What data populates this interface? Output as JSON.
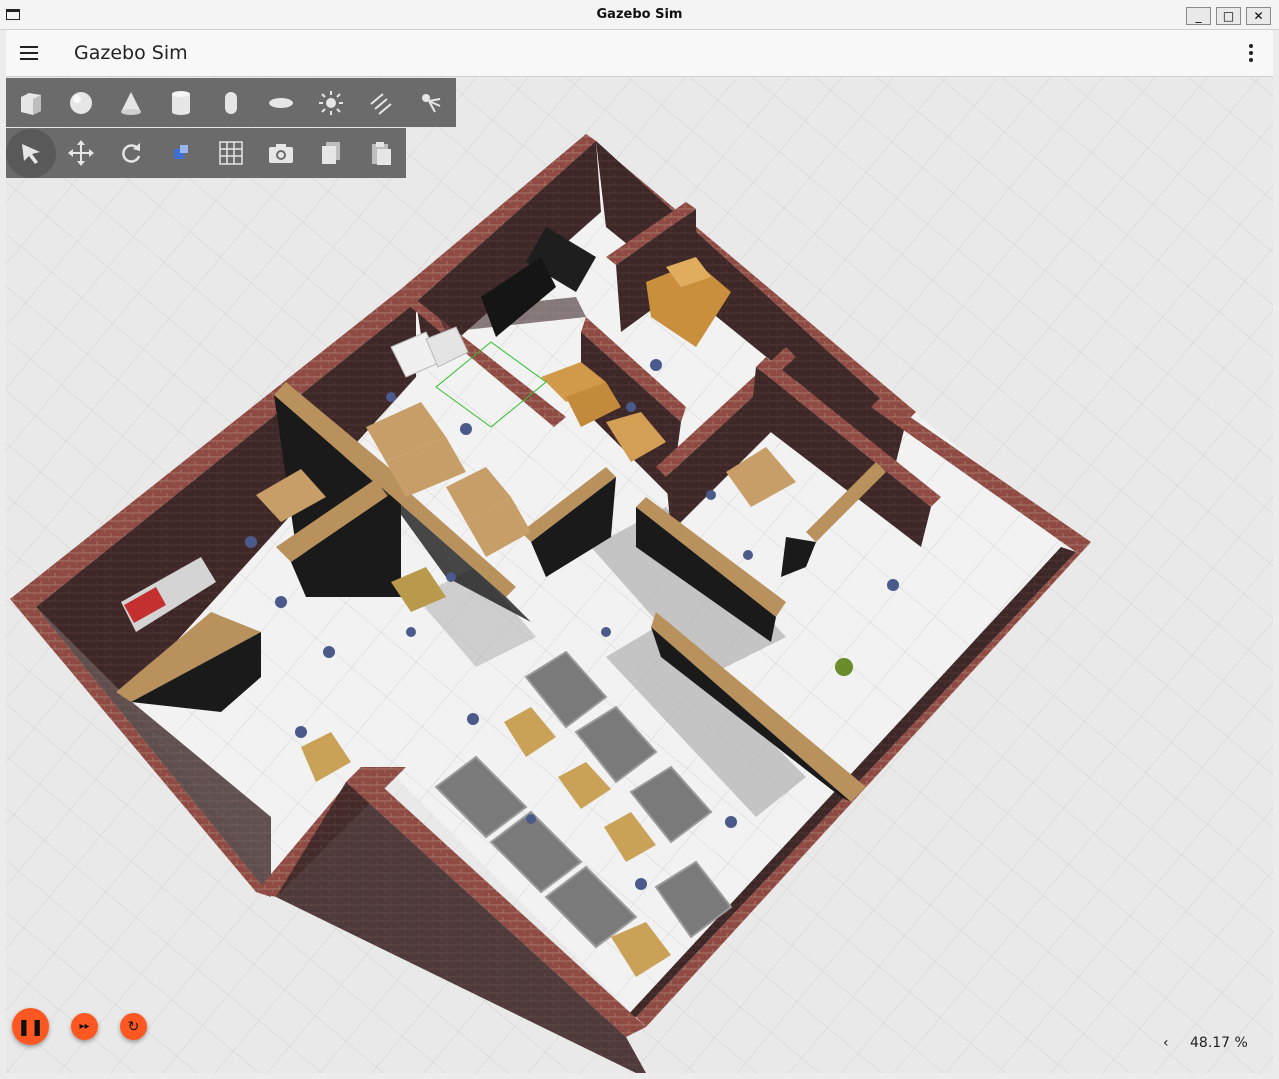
{
  "window": {
    "title": "Gazebo Sim",
    "minimize": "_",
    "maximize": "□",
    "close": "✕"
  },
  "appbar": {
    "title": "Gazebo Sim"
  },
  "shapes_toolbar": [
    "box-icon",
    "sphere-icon",
    "cone-icon",
    "cylinder-icon",
    "capsule-icon",
    "ellipsoid-icon",
    "point-light-icon",
    "directional-light-icon",
    "spot-light-icon"
  ],
  "transform_toolbar": [
    "select-icon",
    "translate-icon",
    "rotate-icon",
    "transform-gizmo-icon",
    "grid-snap-icon",
    "screenshot-icon",
    "copy-icon",
    "paste-icon"
  ],
  "playback": {
    "play_pause": "❚❚",
    "step": "▸▸",
    "reset": "↻"
  },
  "status": {
    "collapse": "‹",
    "rtf": "48.17 %"
  },
  "colors": {
    "accent": "#ff5722",
    "toolbar": "#6b6b6b",
    "brick": "#8e4a43",
    "floor": "#f2f2f2",
    "wood": "#b8915c"
  }
}
